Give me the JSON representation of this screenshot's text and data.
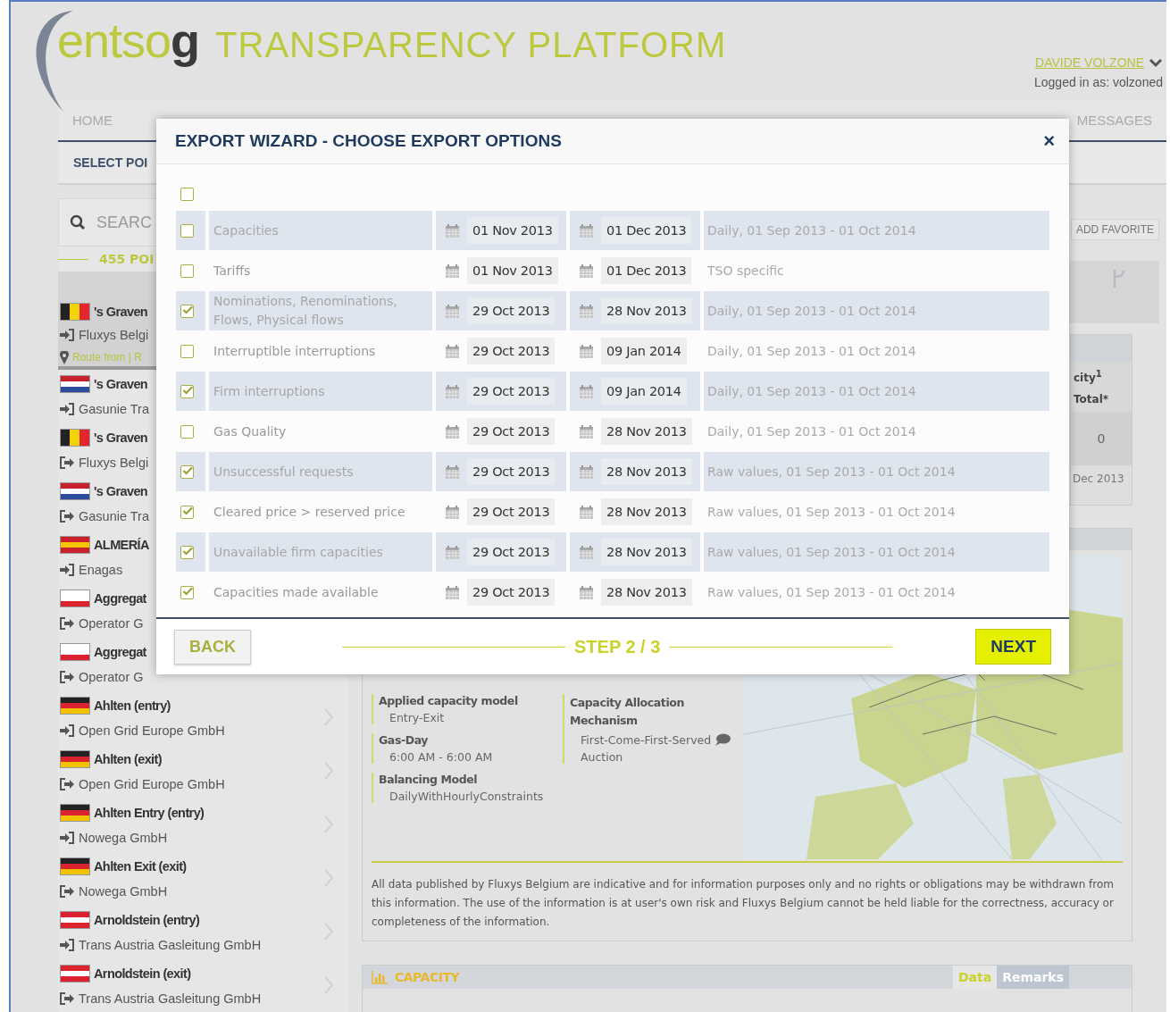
{
  "header": {
    "logo": "entso**g**",
    "title": "TRANSPARENCY PLATFORM",
    "user": "DAVIDE VOLZONE",
    "login": "Logged in as: volzoned"
  },
  "nav": {
    "left": [
      {
        "label": "HOME",
        "selected": false
      }
    ],
    "right": [
      {
        "label": "MESSAGES",
        "selected": false
      }
    ]
  },
  "subnav": {
    "label": "SELECT POI"
  },
  "sidebar": {
    "search_placeholder": "SEARC",
    "count": "455 POI",
    "items": [
      {
        "name": "'s Graven",
        "operator": "Fluxys Belgi",
        "flag": {
          "kind": "be"
        },
        "kind": "entry",
        "selected": true,
        "route": "Route from | R"
      },
      {
        "name": "'s Graven",
        "operator": "Gasunie Tra",
        "flag": {
          "kind": "nl"
        },
        "kind": "entry",
        "selected": false
      },
      {
        "name": "'s Graven",
        "operator": "Fluxys Belgi",
        "flag": {
          "kind": "be"
        },
        "kind": "exit",
        "selected": false
      },
      {
        "name": "'s Graven",
        "operator": "Gasunie Tra",
        "flag": {
          "kind": "nl"
        },
        "kind": "exit",
        "selected": false
      },
      {
        "name": "ALMERÍA",
        "operator": "Enagas",
        "flag": {
          "kind": "es"
        },
        "kind": "entry",
        "selected": false
      },
      {
        "name": "Aggregat",
        "operator": "Operator G",
        "flag": {
          "kind": "pl"
        },
        "kind": "exit",
        "selected": false
      },
      {
        "name": "Aggregat",
        "operator": "Operator G",
        "flag": {
          "kind": "pl"
        },
        "kind": "exit",
        "selected": false
      },
      {
        "name": "Ahlten (entry)",
        "operator": "Open Grid Europe GmbH",
        "flag": {
          "kind": "de"
        },
        "kind": "entry",
        "selected": false
      },
      {
        "name": "Ahlten (exit)",
        "operator": "Open Grid Europe GmbH",
        "flag": {
          "kind": "de"
        },
        "kind": "exit",
        "selected": false
      },
      {
        "name": "Ahlten Entry (entry)",
        "operator": "Nowega GmbH",
        "flag": {
          "kind": "de"
        },
        "kind": "entry",
        "selected": false
      },
      {
        "name": "Ahlten Exit (exit)",
        "operator": "Nowega GmbH",
        "flag": {
          "kind": "de"
        },
        "kind": "exit",
        "selected": false
      },
      {
        "name": "Arnoldstein (entry)",
        "operator": "Trans Austria Gasleitung GmbH",
        "flag": {
          "kind": "at"
        },
        "kind": "entry",
        "selected": false
      },
      {
        "name": "Arnoldstein (exit)",
        "operator": "Trans Austria Gasleitung GmbH",
        "flag": {
          "kind": "at"
        },
        "kind": "exit",
        "selected": false
      }
    ]
  },
  "main": {
    "add_favorite": "ADD FAVORITE",
    "table": {
      "header": "city$^{1}$",
      "subheader": "Total*",
      "value": "0",
      "date": "Dec 2013"
    },
    "info": {
      "left": [
        {
          "label": "Applied capacity model",
          "values": [
            "Entry-Exit"
          ]
        },
        {
          "label": "Gas-Day",
          "values": [
            "6:00 AM - 6:00 AM"
          ]
        },
        {
          "label": "Balancing Model",
          "values": [
            "DailyWithHourlyConstraints"
          ]
        }
      ],
      "right": [
        {
          "label": "Capacity Allocation Mechanism",
          "values": [
            "First-Come-First-Served",
            "Auction"
          ]
        }
      ],
      "disclaimer": "All data published by Fluxys Belgium are indicative and for information purposes only and no rights or obligations may be withdrawn from this information. The use of the information is at user's own risk and Fluxys Belgium cannot be held liable for the correctness, accuracy or completeness of the information."
    },
    "capacity": {
      "title": "CAPACITY",
      "tabs": [
        {
          "label": "Data",
          "selected": true
        },
        {
          "label": "Remarks",
          "selected": false
        }
      ]
    }
  },
  "modal": {
    "title": "EXPORT WIZARD - CHOOSE EXPORT OPTIONS",
    "close": "×",
    "select_all": {
      "checked": false
    },
    "rows": [
      {
        "label": "Capacities",
        "checked": false,
        "from": "01 Nov 2013",
        "to": "01 Dec 2013",
        "info": "Daily, 01 Sep 2013 - 01 Oct 2014"
      },
      {
        "label": "Tariffs",
        "checked": false,
        "from": "01 Nov 2013",
        "to": "01 Dec 2013",
        "info": "TSO specific"
      },
      {
        "label": "Nominations, Renominations, Flows, Physical flows",
        "checked": true,
        "from": "29 Oct 2013",
        "to": "28 Nov 2013",
        "info": "Daily, 01 Sep 2013 - 01 Oct 2014"
      },
      {
        "label": "Interruptible interruptions",
        "checked": false,
        "from": "29 Oct 2013",
        "to": "09 Jan 2014",
        "info": "Daily, 01 Sep 2013 - 01 Oct 2014"
      },
      {
        "label": "Firm interruptions",
        "checked": true,
        "from": "29 Oct 2013",
        "to": "09 Jan 2014",
        "info": "Daily, 01 Sep 2013 - 01 Oct 2014"
      },
      {
        "label": "Gas Quality",
        "checked": false,
        "from": "29 Oct 2013",
        "to": "28 Nov 2013",
        "info": "Daily, 01 Sep 2013 - 01 Oct 2014"
      },
      {
        "label": "Unsuccessful requests",
        "checked": true,
        "from": "29 Oct 2013",
        "to": "28 Nov 2013",
        "info": "Raw values, 01 Sep 2013 - 01 Oct 2014"
      },
      {
        "label": "Cleared price > reserved price",
        "checked": true,
        "from": "29 Oct 2013",
        "to": "28 Nov 2013",
        "info": "Raw values, 01 Sep 2013 - 01 Oct 2014"
      },
      {
        "label": "Unavailable firm capacities",
        "checked": true,
        "from": "29 Oct 2013",
        "to": "28 Nov 2013",
        "info": "Raw values, 01 Sep 2013 - 01 Oct 2014"
      },
      {
        "label": "Capacities made available",
        "checked": true,
        "from": "29 Oct 2013",
        "to": "28 Nov 2013",
        "info": "Raw values, 01 Sep 2013 - 01 Oct 2014"
      }
    ],
    "back": "BACK",
    "step": "STEP 2 / 3",
    "next": "NEXT"
  }
}
